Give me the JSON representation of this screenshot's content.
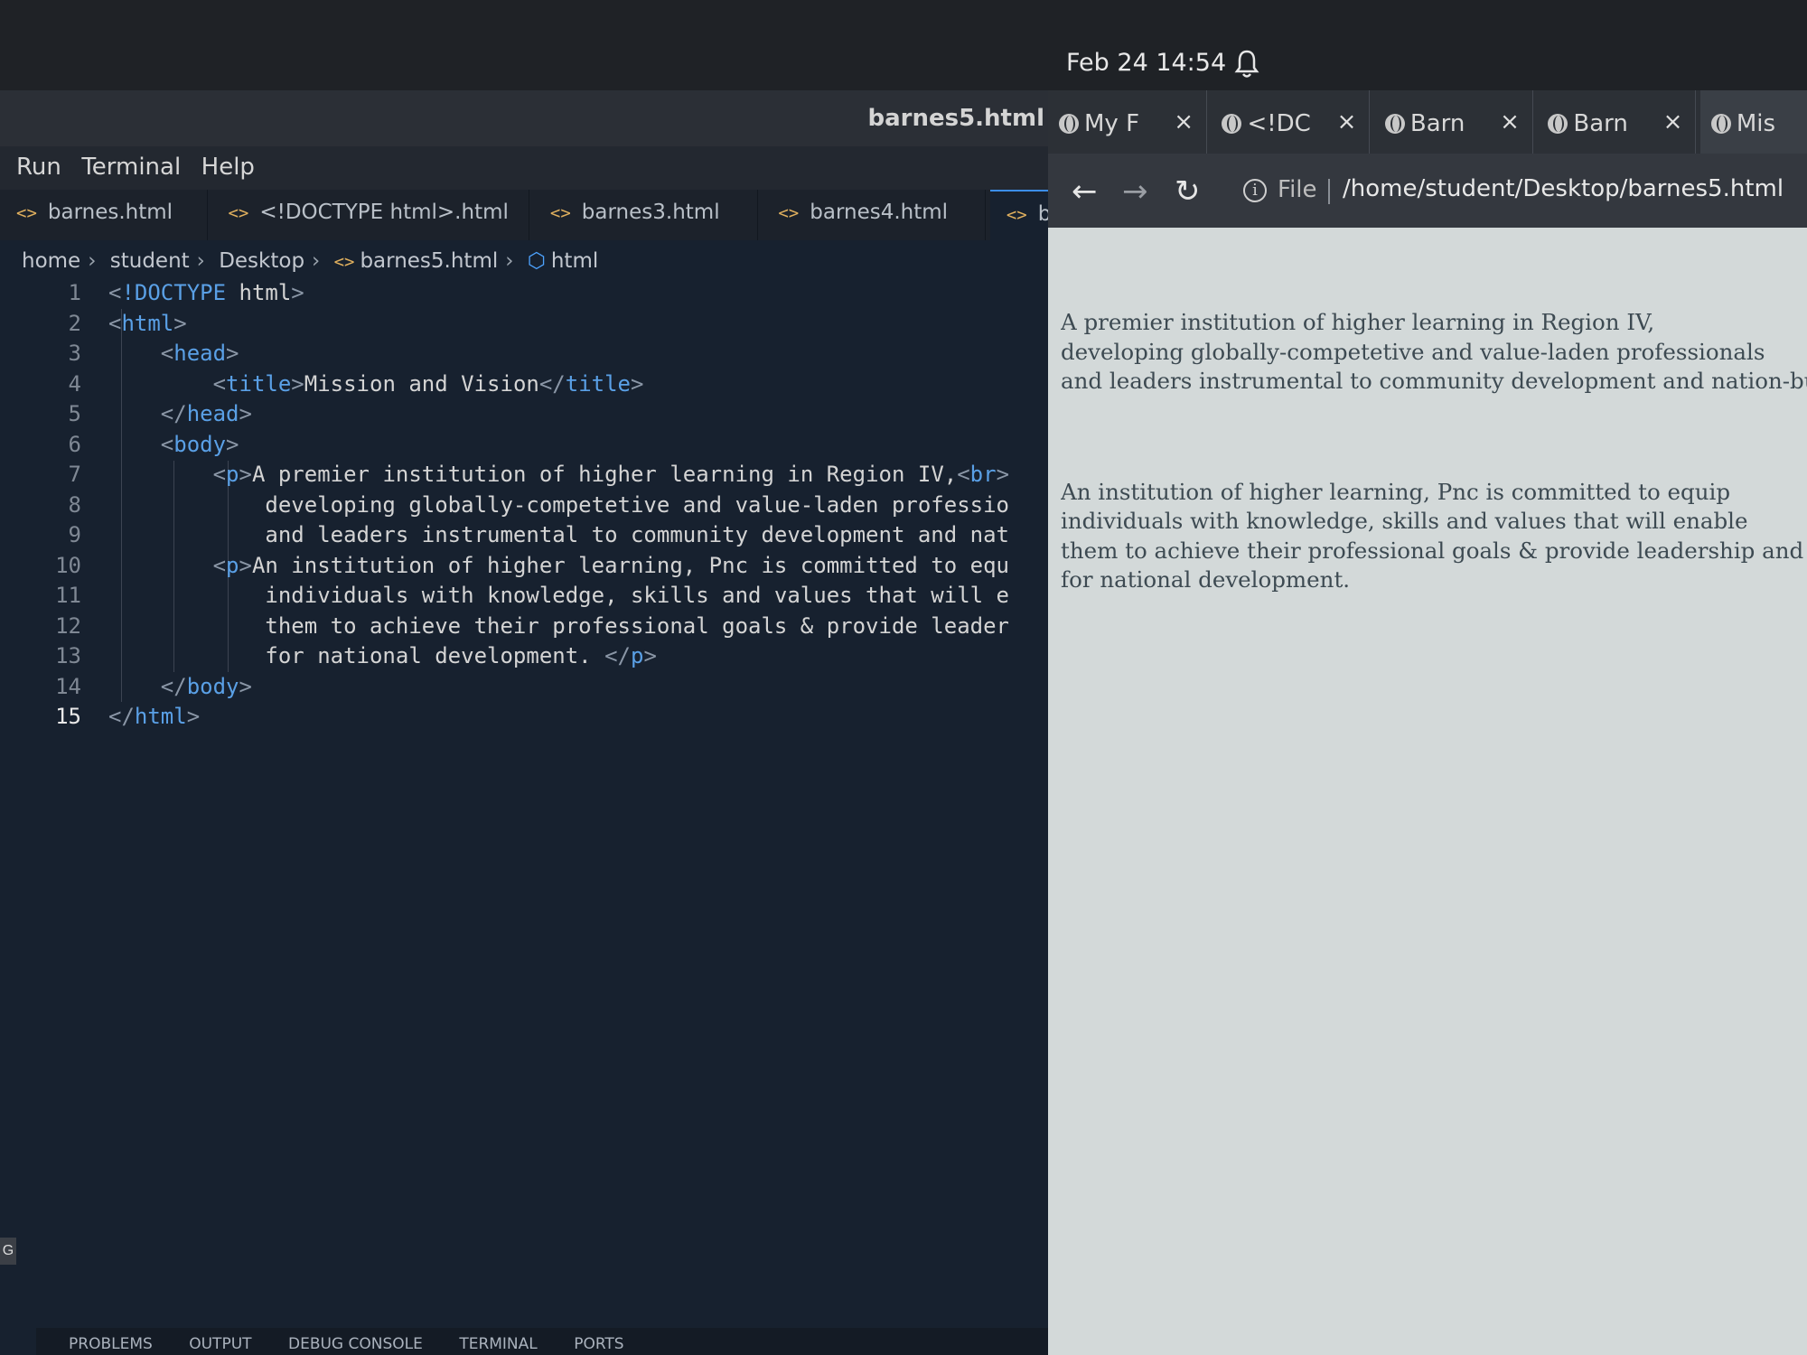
{
  "system": {
    "clock": "Feb 24  14:54"
  },
  "editor": {
    "window_title": "barnes5.html",
    "menu": [
      "Run",
      "Terminal",
      "Help"
    ],
    "tabs": [
      "barnes.html",
      "<!DOCTYPE html>.html",
      "barnes3.html",
      "barnes4.html",
      "ba"
    ],
    "breadcrumb": [
      "home",
      "student",
      "Desktop",
      "barnes5.html",
      "html"
    ],
    "panel_tabs": [
      "PROBLEMS",
      "OUTPUT",
      "DEBUG CONSOLE",
      "TERMINAL",
      "PORTS"
    ],
    "side_badge": "G",
    "lines": [
      {
        "n": "1",
        "t": "<!DOCTYPE html>"
      },
      {
        "n": "2",
        "t": "<html>"
      },
      {
        "n": "3",
        "t": "    <head>"
      },
      {
        "n": "4",
        "t": "        <title>Mission and Vision</title>"
      },
      {
        "n": "5",
        "t": "    </head>"
      },
      {
        "n": "6",
        "t": "    <body>"
      },
      {
        "n": "7",
        "t": "        <p>A premier institution of higher learning in Region IV,<br>"
      },
      {
        "n": "8",
        "t": "            developing globally-competetive and value-laden professio"
      },
      {
        "n": "9",
        "t": "            and leaders instrumental to community development and nat"
      },
      {
        "n": "10",
        "t": "        <p>An institution of higher learning, Pnc is committed to equ"
      },
      {
        "n": "11",
        "t": "            individuals with knowledge, skills and values that will e"
      },
      {
        "n": "12",
        "t": "            them to achieve their professional goals & provide leader"
      },
      {
        "n": "13",
        "t": "            for national development. </p>"
      },
      {
        "n": "14",
        "t": "    </body>"
      },
      {
        "n": "15",
        "t": "</html>"
      }
    ]
  },
  "browser": {
    "tabs": [
      "My F",
      "<!DC",
      "Barn",
      "Barn",
      "Mis"
    ],
    "file_label": "File",
    "url": "/home/student/Desktop/barnes5.html",
    "paragraph1": "A premier institution of higher learning in Region IV,\ndeveloping globally-competetive and value-laden professionals\nand leaders instrumental to community development and nation-building",
    "paragraph2": "An institution of higher learning, Pnc is committed to equip\nindividuals with knowledge, skills and values that will enable\nthem to achieve their professional goals & provide leadership and service\nfor national development."
  }
}
